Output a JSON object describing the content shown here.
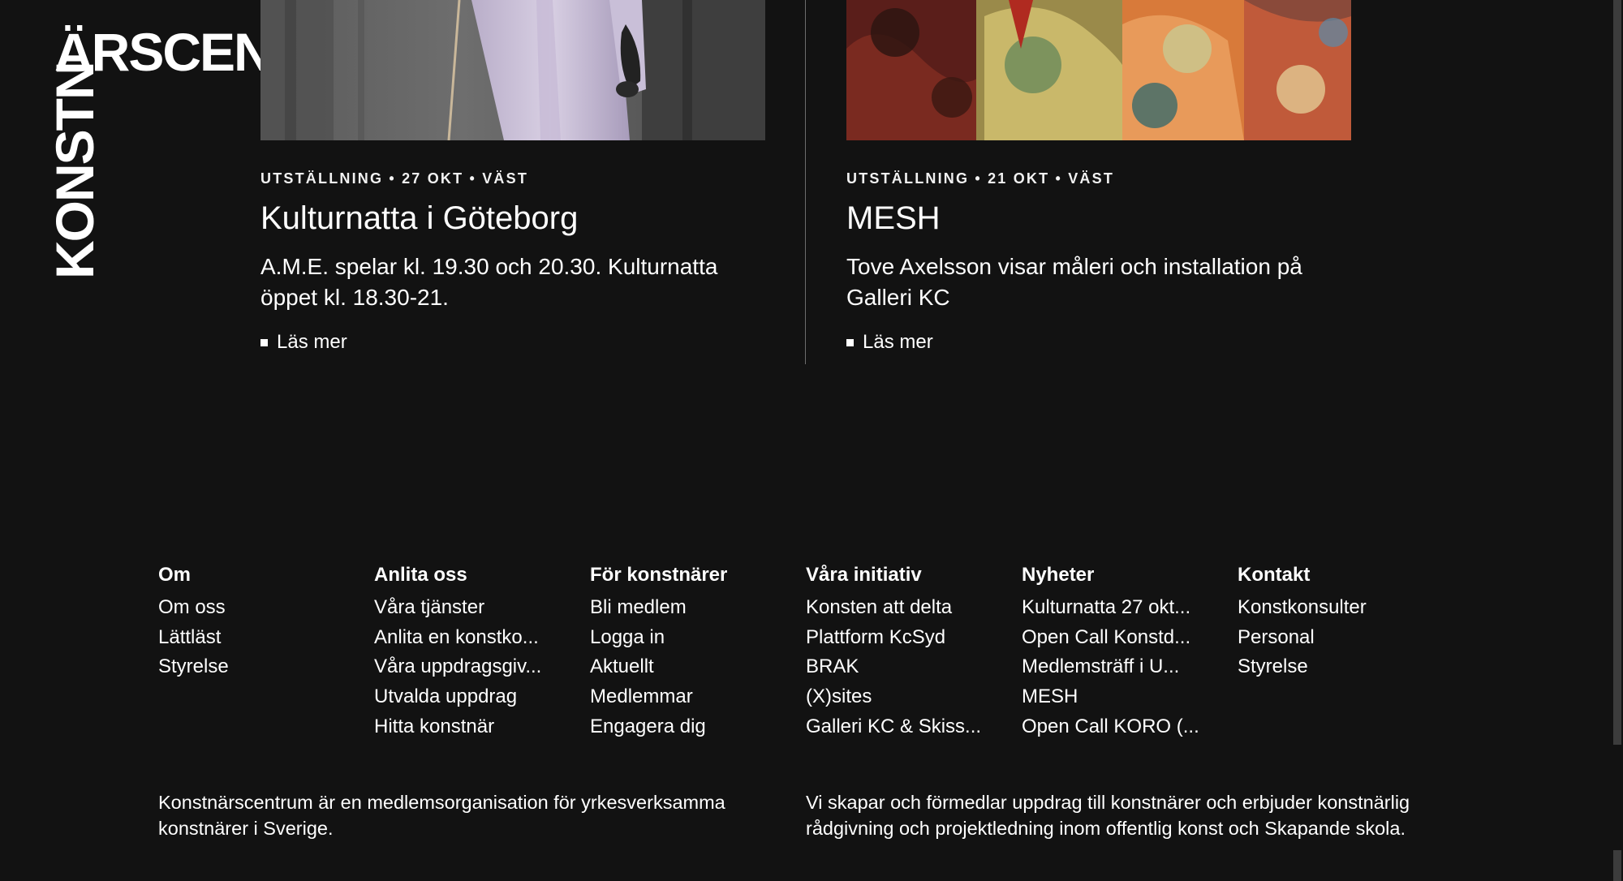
{
  "logo": {
    "horizontal": "ÄRSCENTRUM",
    "vertical": "KONSTN"
  },
  "cards": [
    {
      "meta": "UTSTÄLLNING • 27 OKT • VÄST",
      "title": "Kulturnatta i Göteborg",
      "description": "A.M.E. spelar kl. 19.30 och 20.30. Kulturnatta öppet kl. 18.30-21.",
      "read_more": "Läs mer"
    },
    {
      "meta": "UTSTÄLLNING • 21 OKT • VÄST",
      "title": "MESH",
      "description": "Tove Axelsson visar måleri och installation på Galleri KC",
      "read_more": "Läs mer"
    }
  ],
  "footer_nav": [
    {
      "heading": "Om",
      "links": [
        "Om oss",
        "Lättläst",
        "Styrelse"
      ]
    },
    {
      "heading": "Anlita oss",
      "links": [
        "Våra tjänster",
        "Anlita en konstko...",
        "Våra uppdragsgiv...",
        "Utvalda uppdrag",
        "Hitta konstnär"
      ]
    },
    {
      "heading": "För konstnärer",
      "links": [
        "Bli medlem",
        "Logga in",
        "Aktuellt",
        "Medlemmar",
        "Engagera dig"
      ]
    },
    {
      "heading": "Våra initiativ",
      "links": [
        "Konsten att delta",
        "Plattform KcSyd",
        "BRAK",
        "(X)sites",
        "Galleri KC & Skiss..."
      ]
    },
    {
      "heading": "Nyheter",
      "links": [
        "Kulturnatta 27 okt...",
        "Open Call Konstd...",
        "Medlemsträff i U...",
        "MESH",
        "Open Call KORO (..."
      ]
    },
    {
      "heading": "Kontakt",
      "links": [
        "Konstkonsulter",
        "Personal",
        "Styrelse"
      ]
    }
  ],
  "about": {
    "left": "Konstnärscentrum är en medlemsorganisation för yrkesverksamma konstnärer i Sverige.",
    "right": "Vi skapar och förmedlar uppdrag till konstnärer och erbjuder konstnärlig rådgivning och projektledning inom offentlig konst och Skapande skola."
  },
  "colors": {
    "background": "#121212",
    "text": "#ffffff",
    "divider": "#6d6d6d"
  }
}
